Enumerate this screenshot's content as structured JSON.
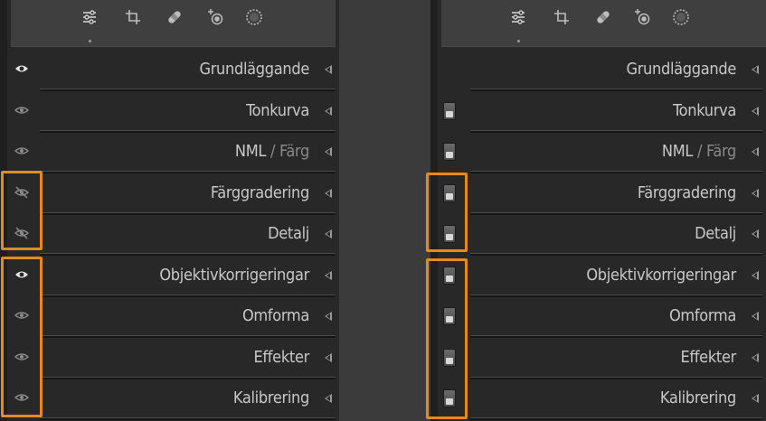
{
  "colors": {
    "highlight": "#e8891b",
    "panel": "#282828",
    "gap": "#3b3b3b",
    "text": "#c8c8c8"
  },
  "toolstrip": {
    "tools": [
      "edit-sliders-icon",
      "crop-icon",
      "healing-bandage-icon",
      "red-eye-icon",
      "masking-icon"
    ]
  },
  "left_panel": {
    "sections": [
      {
        "label": "Grundläggande",
        "visibility": "eye-bright"
      },
      {
        "label": "Tonkurva",
        "visibility": "eye"
      },
      {
        "label": "NML",
        "sub": " / Färg",
        "visibility": "eye"
      },
      {
        "label": "Färggradering",
        "visibility": "eye-hidden"
      },
      {
        "label": "Detalj",
        "visibility": "eye-hidden"
      },
      {
        "label": "Objektivkorrigeringar",
        "visibility": "eye-bright"
      },
      {
        "label": "Omforma",
        "visibility": "eye"
      },
      {
        "label": "Effekter",
        "visibility": "eye"
      },
      {
        "label": "Kalibrering",
        "visibility": "eye"
      }
    ]
  },
  "right_panel": {
    "sections": [
      {
        "label": "Grundläggande",
        "toggle": "none"
      },
      {
        "label": "Tonkurva",
        "toggle": "switch"
      },
      {
        "label": "NML",
        "sub": " / Färg",
        "toggle": "switch"
      },
      {
        "label": "Färggradering",
        "toggle": "switch"
      },
      {
        "label": "Detalj",
        "toggle": "switch"
      },
      {
        "label": "Objektivkorrigeringar",
        "toggle": "switch"
      },
      {
        "label": "Omforma",
        "toggle": "switch"
      },
      {
        "label": "Effekter",
        "toggle": "switch"
      },
      {
        "label": "Kalibrering",
        "toggle": "switch"
      }
    ]
  }
}
